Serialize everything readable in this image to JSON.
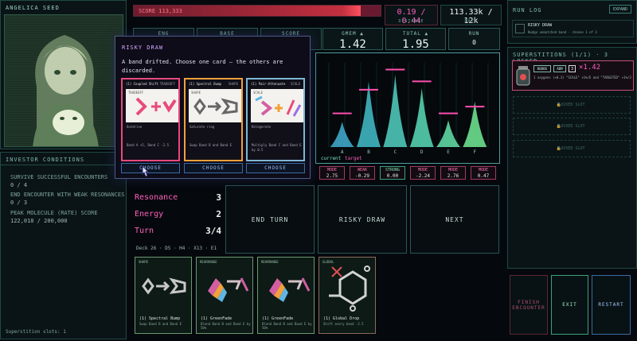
{
  "portrait": {
    "name": "ANGELICA SEED"
  },
  "investor": {
    "title": "INVESTOR CONDITIONS",
    "conditions": [
      {
        "label": "SURVIVE SUCCESSFUL ENCOUNTERS",
        "value": "0 / 4"
      },
      {
        "label": "END ENCOUNTER WITH WEAK RESONANCES",
        "value": "0 / 3"
      },
      {
        "label": "PEAK MOLECULE (RATE) SCORE",
        "value": "122,018 / 200,000"
      }
    ],
    "slots": "Superstition slots: 1"
  },
  "score": {
    "label": "SCORE 113,333",
    "fill_percent": 92
  },
  "distance": {
    "value": "0.19 / 0.44",
    "label": "DISTANCE"
  },
  "rate": {
    "value": "113.33k / 12k",
    "label": "RATE"
  },
  "metrics": {
    "row1": [
      "ENG",
      "BASE",
      "SCORE"
    ],
    "gmem": {
      "label": "GMEM ▲",
      "value": "1.42"
    },
    "total": {
      "label": "TOTAL ▲",
      "value": "1.95"
    },
    "run": {
      "label": "RUN",
      "value": "0"
    }
  },
  "chart_data": {
    "type": "bar",
    "categories": [
      "A",
      "B",
      "C",
      "D",
      "E",
      "F"
    ],
    "series": [
      {
        "name": "current",
        "values": [
          0.3,
          0.78,
          0.86,
          0.7,
          0.32,
          0.54
        ]
      },
      {
        "name": "target",
        "values": [
          0.4,
          0.68,
          0.92,
          0.78,
          0.4,
          0.48
        ]
      }
    ],
    "legend": [
      "current",
      "target"
    ],
    "ylim": [
      0,
      1
    ]
  },
  "band_tags": [
    {
      "name": "MODE",
      "value": "2.75"
    },
    {
      "name": "WEAK",
      "value": "-0.29"
    },
    {
      "name": "STRONG",
      "value": "0.00"
    },
    {
      "name": "MODE",
      "value": "-2.24"
    },
    {
      "name": "MODE",
      "value": "2.76"
    },
    {
      "name": "MODE",
      "value": "0.47"
    }
  ],
  "stats": [
    {
      "name": "Resonance",
      "value": "3"
    },
    {
      "name": "Energy",
      "value": "2"
    },
    {
      "name": "Turn",
      "value": "3/4"
    }
  ],
  "deck": "Deck 26 · D5 · H4 · X13 · E1",
  "buttons": {
    "end_turn": "END TURN",
    "risky_draw": "RISKY DRAW",
    "next": "NEXT"
  },
  "hand": [
    {
      "type": "SHAPE",
      "name": "(1) Spectral Bump",
      "desc": "Swap Band B and Band E"
    },
    {
      "type": "REARRANGE",
      "name": "(1) GreenFade",
      "desc": "Blend Band B and Band E by 50%"
    },
    {
      "type": "REARRANGE",
      "name": "(1) GreenFade",
      "desc": "Blend Band B and Band E by 50%"
    },
    {
      "type": "GLOBAL",
      "name": "(1) Global Drop",
      "desc": "Shift every band -2.5"
    }
  ],
  "runlog": {
    "title": "RUN LOG",
    "expand": "EXPAND",
    "entry_title": "RISKY DRAW",
    "entry_desc": "Nudge unmatched band · choose 1 of 3"
  },
  "superstitions": {
    "title": "SUPERSTITIONS (1/1) · 3 LOCKED",
    "badge1": "BOOBS",
    "badge2": "ADM",
    "level": "3",
    "mult": "×1.42",
    "desc": "1 oxygens (+0.3) \"SCALE\" +1%/E and \"TARGETED\" +1%/3",
    "locked": "LOCKED SLOT"
  },
  "actions": {
    "finish": "FINISH ENCOUNTER",
    "exit": "EXIT",
    "restart": "RESTART"
  },
  "modal": {
    "title": "RISKY DRAW",
    "desc": "A band drifted. Choose one card — the others are discarded.",
    "choose": "CHOOSE",
    "cards": [
      {
        "name": "(1) Coupled Shift",
        "kind": "TRADEOFF",
        "tag": "TRADEOFF",
        "flavor": "Outdrive",
        "desc": "Band A +5, Band C -2.5",
        "color": "#e8487e",
        "art": "pink"
      },
      {
        "name": "(1) Spectral Bump",
        "kind": "SHAPE",
        "tag": "SHAPE",
        "flavor": "Saturate ring",
        "desc": "Swap Band B and Band E",
        "color": "#f2a03c",
        "art": "gray"
      },
      {
        "name": "(1) Pair-Attenuate",
        "kind": "SCALE",
        "tag": "SCALE",
        "flavor": "Relegerate",
        "desc": "Multiply Band C and Band E by 0.5",
        "color": "#7fb6d6",
        "art": "multi"
      }
    ]
  }
}
